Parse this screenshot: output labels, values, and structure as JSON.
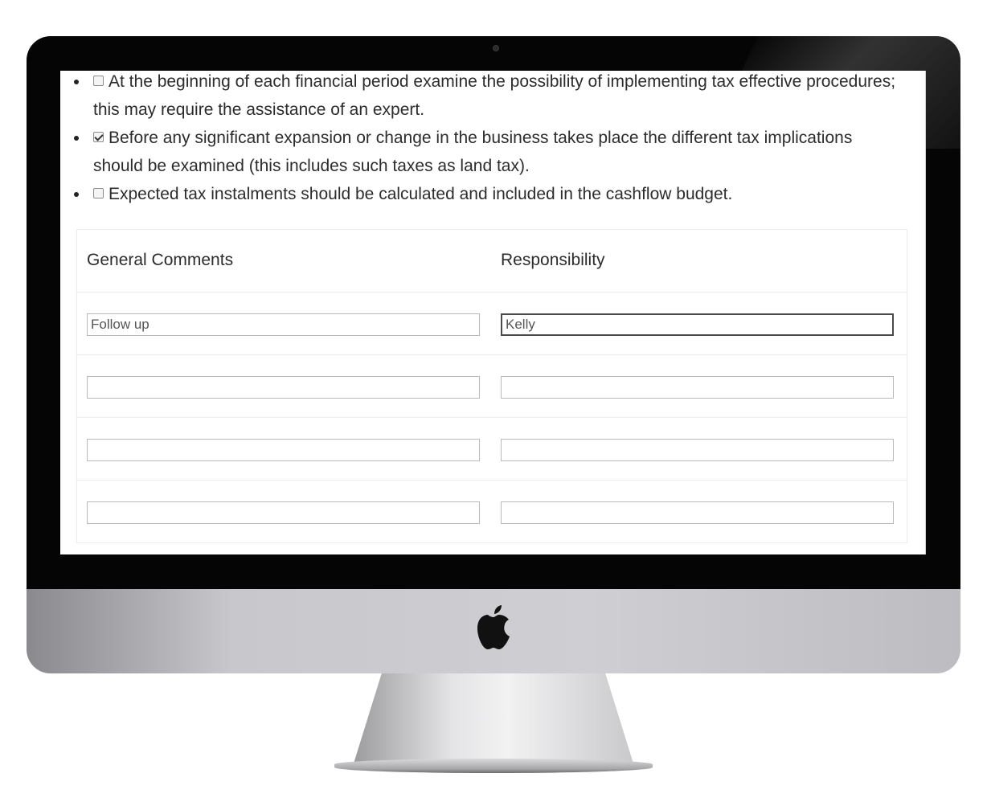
{
  "checklist": [
    {
      "checked": false,
      "text": "At the beginning of each financial period examine the possibility of implementing tax effective procedures; this may require the assistance of an expert."
    },
    {
      "checked": true,
      "text": "Before any significant expansion or change in the business takes place the different tax implications should be examined (this includes such taxes as land tax)."
    },
    {
      "checked": false,
      "text": "Expected tax instalments should be calculated and included in the cashflow budget."
    }
  ],
  "table": {
    "col_comments": "General Comments",
    "col_responsibility": "Responsibility",
    "rows": [
      {
        "comment": "Follow up",
        "responsibility": "Kelly"
      },
      {
        "comment": "",
        "responsibility": ""
      },
      {
        "comment": "",
        "responsibility": ""
      },
      {
        "comment": "",
        "responsibility": ""
      }
    ]
  },
  "icons": {
    "logo": "apple-logo-icon",
    "camera": "camera-icon"
  }
}
